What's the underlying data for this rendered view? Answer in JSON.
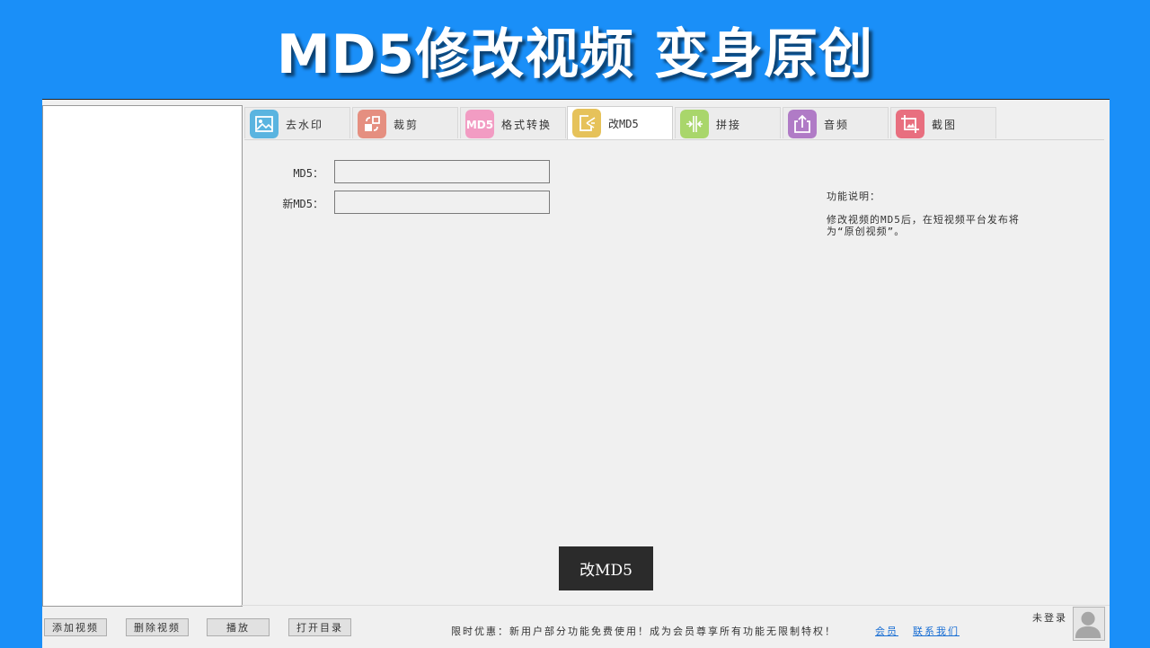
{
  "banner": {
    "title": "MD5修改视频 变身原创"
  },
  "tabs": [
    {
      "label": "去水印",
      "icon": "image-watermark-icon",
      "color": "#5ab4e0"
    },
    {
      "label": "裁剪",
      "icon": "crop-icon",
      "color": "#e58f80"
    },
    {
      "label": "格式转换",
      "icon": "md5-format-icon",
      "icon_text": "MD5",
      "color": "#f29cc3"
    },
    {
      "label": "改MD5",
      "icon": "edit-file-icon",
      "color": "#e6c25a"
    },
    {
      "label": "拼接",
      "icon": "merge-icon",
      "color": "#a9d66b"
    },
    {
      "label": "音频",
      "icon": "upload-audio-icon",
      "color": "#b07bc6"
    },
    {
      "label": "截图",
      "icon": "screenshot-icon",
      "color": "#e86f7f"
    }
  ],
  "active_tab": "改MD5",
  "form": {
    "md5_label": "MD5：",
    "md5_value": "",
    "new_md5_label": "新MD5：",
    "new_md5_value": ""
  },
  "description": {
    "heading": "功能说明：",
    "line1": "修改视频的MD5后，在短视频平台发布将",
    "line2": "为“原创视频”。"
  },
  "primary_button": "改MD5",
  "toolbar": {
    "add_video": "添加视频",
    "delete_video": "删除视频",
    "play": "播放",
    "open_dir": "打开目录"
  },
  "footer": {
    "promo": "限时优惠：新用户部分功能免费使用！成为会员尊享所有功能无限制特权！",
    "member_link": "会员",
    "contact_link": "联系我们",
    "login_status": "未登录"
  },
  "colors": {
    "background": "#1a8ff8",
    "window": "#f0f0f0",
    "primary_button": "#2b2b2b",
    "link": "#1a6fd4"
  }
}
